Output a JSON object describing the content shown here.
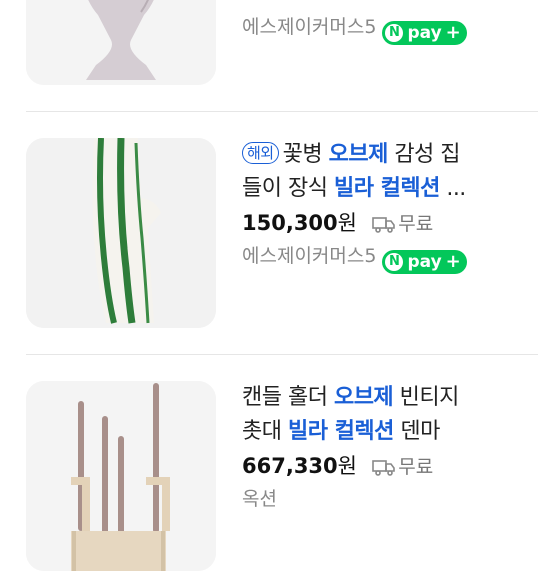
{
  "items": [
    {
      "seller": "에스제이커머스5",
      "npay_label": "pay"
    },
    {
      "tag": "해외",
      "title_line1": [
        {
          "text": "꽃병 ",
          "hl": false
        },
        {
          "text": "오브제",
          "hl": true
        },
        {
          "text": " 감성 집",
          "hl": false
        }
      ],
      "title_line2": [
        {
          "text": "들이 장식 ",
          "hl": false
        },
        {
          "text": "빌라 컬렉션",
          "hl": true
        },
        {
          "text": " ...",
          "hl": false
        }
      ],
      "price": "150,300",
      "currency": "원",
      "shipping": "무료",
      "seller": "에스제이커머스5",
      "npay_label": "pay"
    },
    {
      "title_line1": [
        {
          "text": "캔들 홀더 ",
          "hl": false
        },
        {
          "text": "오브제",
          "hl": true
        },
        {
          "text": " 빈티지",
          "hl": false
        }
      ],
      "title_line2": [
        {
          "text": "촛대 ",
          "hl": false
        },
        {
          "text": "빌라 컬렉션",
          "hl": true
        },
        {
          "text": " 덴마",
          "hl": false
        }
      ],
      "price": "667,330",
      "currency": "원",
      "shipping": "무료",
      "seller": "옥션"
    }
  ],
  "colors": {
    "highlight": "#1a5fd6",
    "npay": "#03c75a"
  }
}
